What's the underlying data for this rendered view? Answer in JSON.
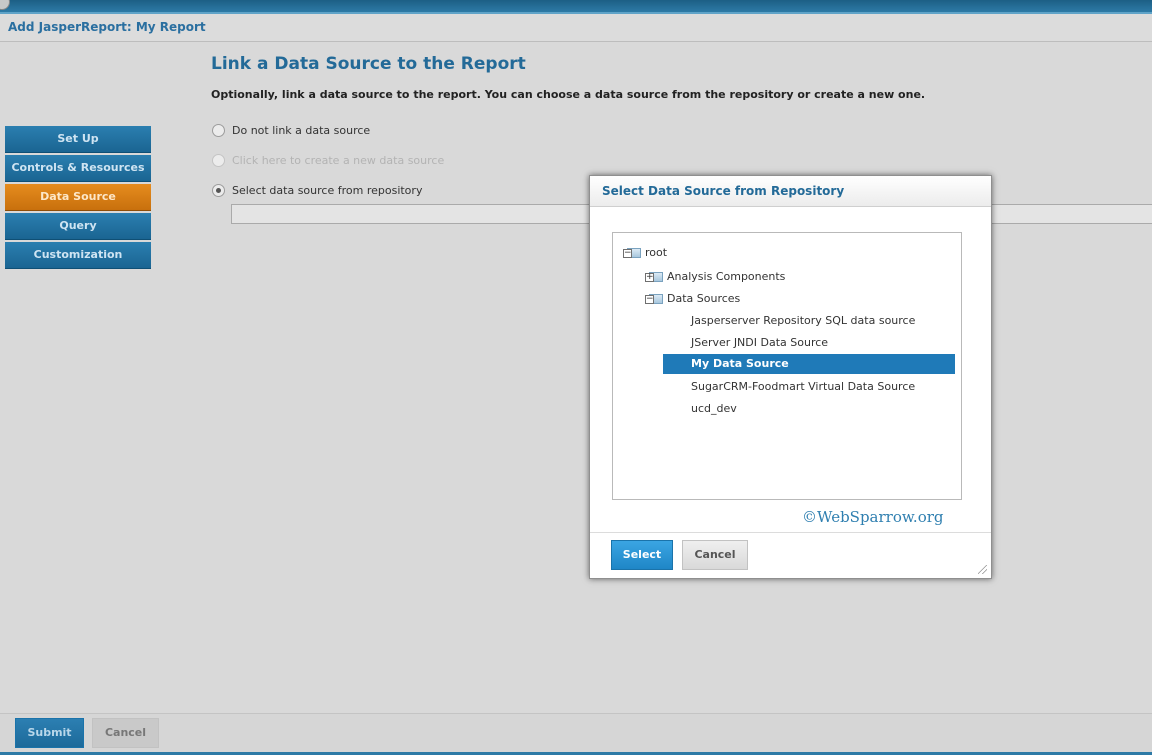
{
  "window": {
    "title": "Add JasperReport: My Report"
  },
  "nav": {
    "items": [
      {
        "label": "Set Up",
        "active": false
      },
      {
        "label": "Controls & Resources",
        "active": false
      },
      {
        "label": "Data Source",
        "active": true
      },
      {
        "label": "Query",
        "active": false
      },
      {
        "label": "Customization",
        "active": false
      }
    ]
  },
  "main": {
    "heading": "Link a Data Source to the Report",
    "description": "Optionally, link a data source to the report. You can choose a data source from the repository or create a new one.",
    "options": [
      {
        "label": "Do not link a data source",
        "checked": false,
        "disabled": false
      },
      {
        "label": "Click here to create a new data source",
        "checked": false,
        "disabled": true
      },
      {
        "label": "Select data source from repository",
        "checked": true,
        "disabled": false
      }
    ],
    "repository_path": ""
  },
  "dialog": {
    "title": "Select Data Source from Repository",
    "tree": {
      "root": "root",
      "folders": [
        {
          "label": "Analysis Components",
          "expanded": false
        },
        {
          "label": "Data Sources",
          "expanded": true
        }
      ],
      "data_sources": [
        "Jasperserver Repository SQL data source",
        "JServer JNDI Data Source",
        "My Data Source",
        "SugarCRM-Foodmart Virtual Data Source",
        "ucd_dev"
      ],
      "selected": "My Data Source"
    },
    "watermark": "©WebSparrow.org",
    "select_label": "Select",
    "cancel_label": "Cancel"
  },
  "footer": {
    "submit_label": "Submit",
    "cancel_label": "Cancel"
  },
  "colors": {
    "accent": "#1f7ab8",
    "active_tab": "#e68c1e",
    "heading": "#236a98"
  }
}
